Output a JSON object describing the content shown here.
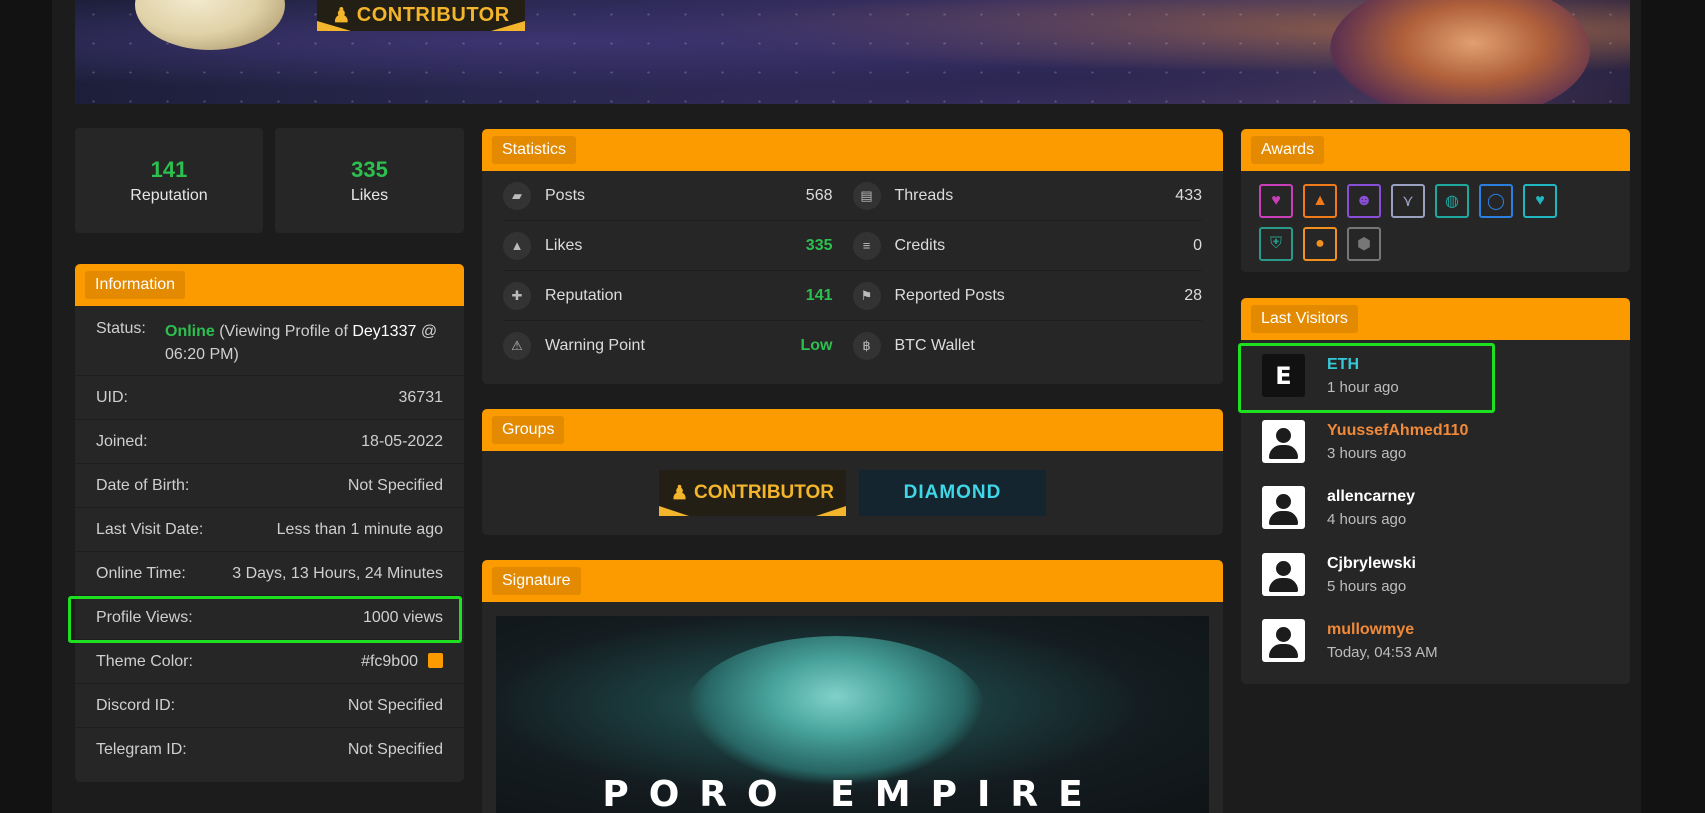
{
  "banner": {
    "badge_label": "CONTRIBUTOR"
  },
  "stats_cards": [
    {
      "value": "141",
      "label": "Reputation"
    },
    {
      "value": "335",
      "label": "Likes"
    }
  ],
  "information": {
    "title": "Information",
    "status_label": "Status:",
    "status_online": "Online",
    "status_text_a": " (Viewing Profile of ",
    "status_user": "Dey1337",
    "status_text_b": " @ 06:20 PM)",
    "rows": [
      {
        "key": "UID:",
        "value": "36731"
      },
      {
        "key": "Joined:",
        "value": "18-05-2022"
      },
      {
        "key": "Date of Birth:",
        "value": "Not Specified"
      },
      {
        "key": "Last Visit Date:",
        "value": "Less than 1 minute ago"
      },
      {
        "key": "Online Time:",
        "value": "3 Days, 13 Hours, 24 Minutes"
      },
      {
        "key": "Profile Views:",
        "value": "1000 views"
      },
      {
        "key": "Theme Color:",
        "value": "#fc9b00"
      },
      {
        "key": "Discord ID:",
        "value": "Not Specified"
      },
      {
        "key": "Telegram ID:",
        "value": "Not Specified"
      }
    ]
  },
  "statistics": {
    "title": "Statistics",
    "left": [
      {
        "label": "Posts",
        "value": "568",
        "icon": "comments-icon"
      },
      {
        "label": "Likes",
        "value": "335",
        "icon": "thumbs-up-icon"
      },
      {
        "label": "Reputation",
        "value": "141",
        "icon": "ribbon-icon"
      },
      {
        "label": "Warning Point",
        "value": "Low",
        "icon": "warning-icon"
      }
    ],
    "right": [
      {
        "label": "Threads",
        "value": "433",
        "icon": "book-icon"
      },
      {
        "label": "Credits",
        "value": "0",
        "icon": "coins-icon"
      },
      {
        "label": "Reported Posts",
        "value": "28",
        "icon": "flag-icon"
      },
      {
        "label": "BTC Wallet",
        "value": "",
        "icon": "bitcoin-icon"
      }
    ]
  },
  "groups": {
    "title": "Groups",
    "items": [
      "CONTRIBUTOR",
      "DIAMOND"
    ]
  },
  "signature": {
    "title": "Signature",
    "image_text": "PORO EMPIRE"
  },
  "awards": {
    "title": "Awards",
    "items": [
      {
        "icon": "heart-icon",
        "glyph": "♥",
        "color": "#c93fb8"
      },
      {
        "icon": "campfire-icon",
        "glyph": "▲",
        "color": "#f07a1a"
      },
      {
        "icon": "devil-icon",
        "glyph": "☻",
        "color": "#8a4fd8"
      },
      {
        "icon": "chevron-icon",
        "glyph": "⋎",
        "color": "#9aa0c0"
      },
      {
        "icon": "planet-icon",
        "glyph": "◍",
        "color": "#1fa8a0"
      },
      {
        "icon": "ring-icon",
        "glyph": "◯",
        "color": "#2a7fe0"
      },
      {
        "icon": "gem-heart-icon",
        "glyph": "♥",
        "color": "#1fb8c0"
      },
      {
        "icon": "shield-icon",
        "glyph": "⛨",
        "color": "#2a9a8a"
      },
      {
        "icon": "pumpkin-icon",
        "glyph": "●",
        "color": "#f09020"
      },
      {
        "icon": "badge-icon",
        "glyph": "⬢",
        "color": "#777777"
      }
    ]
  },
  "last_visitors": {
    "title": "Last Visitors",
    "items": [
      {
        "name": "ETH",
        "time": "1 hour ago",
        "color": "#35c8d8",
        "avatar": "E"
      },
      {
        "name": "YuussefAhmed110",
        "time": "3 hours ago",
        "color": "#f08a3a",
        "avatar": ""
      },
      {
        "name": "allencarney",
        "time": "4 hours ago",
        "color": "#ffffff",
        "avatar": ""
      },
      {
        "name": "Cjbrylewski",
        "time": "5 hours ago",
        "color": "#ffffff",
        "avatar": ""
      },
      {
        "name": "mullowmye",
        "time": "Today, 04:53 AM",
        "color": "#f08a3a",
        "avatar": ""
      }
    ]
  }
}
